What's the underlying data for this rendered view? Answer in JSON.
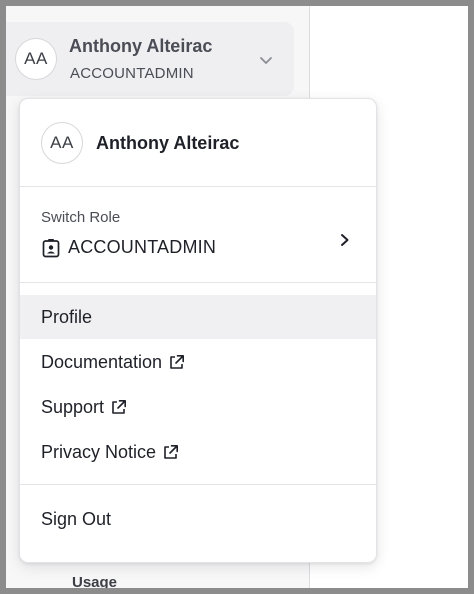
{
  "sidebar_header": {
    "avatar_initials": "AA",
    "user_name": "Anthony Alteirac",
    "role": "ACCOUNTADMIN",
    "chevron": "chevron-down-icon"
  },
  "sidebar": {
    "partial_item": "Usage"
  },
  "menu": {
    "avatar_initials": "AA",
    "user_name": "Anthony Alteirac",
    "switch_role": {
      "label": "Switch Role",
      "current_role": "ACCOUNTADMIN",
      "role_icon": "id-badge-icon",
      "arrow_icon": "chevron-right-icon"
    },
    "items": [
      {
        "label": "Profile",
        "external": false,
        "hovered": true
      },
      {
        "label": "Documentation",
        "external": true,
        "icon": "external-link-icon"
      },
      {
        "label": "Support",
        "external": true,
        "icon": "external-link-icon"
      },
      {
        "label": "Privacy Notice",
        "external": true,
        "icon": "external-link-icon"
      }
    ],
    "sign_out": "Sign Out"
  },
  "colors": {
    "backdrop": "#8c8c8c",
    "panel": "#f7f7f8",
    "header_bg": "#efeff1",
    "hover_bg": "#f0f0f2",
    "text_primary": "#1f2128",
    "text_secondary": "#4a4d55"
  }
}
